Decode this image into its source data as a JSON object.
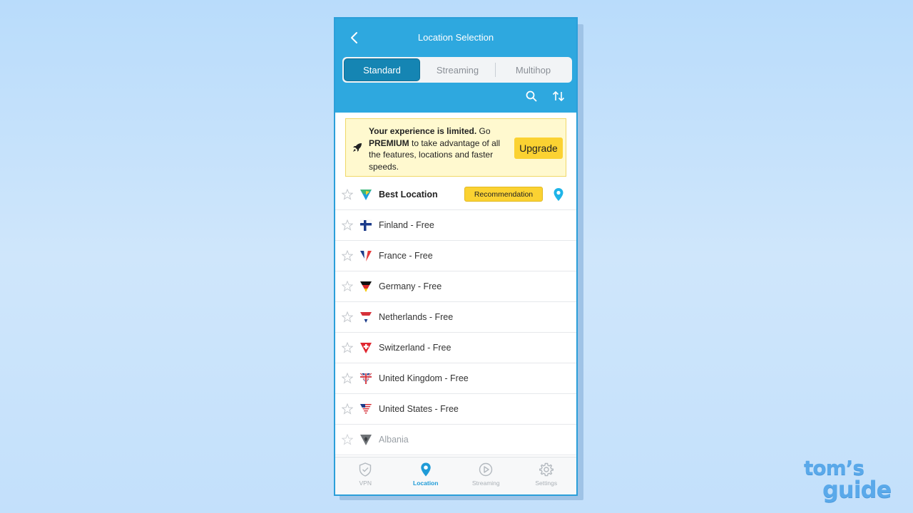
{
  "header": {
    "title": "Location Selection",
    "back_icon": "chevron-left-icon",
    "tools": [
      "search-icon",
      "sort-icon"
    ]
  },
  "tabs": [
    {
      "label": "Standard",
      "active": true
    },
    {
      "label": "Streaming",
      "active": false
    },
    {
      "label": "Multihop",
      "active": false
    }
  ],
  "banner": {
    "icon": "rocket-icon",
    "bold_lead": "Your experience is limited.",
    "text_go": " Go ",
    "bold_premium": "PREMIUM",
    "text_rest": " to take advantage of all the features, locations and faster speeds.",
    "button_label": "Upgrade"
  },
  "locations": [
    {
      "name": "Best Location",
      "badge": "Recommendation",
      "flag": "best-location-flag-icon",
      "bold": true,
      "pin": true
    },
    {
      "name": "Finland - Free",
      "flag": "finland-flag-icon"
    },
    {
      "name": "France - Free",
      "flag": "france-flag-icon"
    },
    {
      "name": "Germany - Free",
      "flag": "germany-flag-icon"
    },
    {
      "name": "Netherlands - Free",
      "flag": "netherlands-flag-icon"
    },
    {
      "name": "Switzerland - Free",
      "flag": "switzerland-flag-icon"
    },
    {
      "name": "United Kingdom - Free",
      "flag": "uk-flag-icon"
    },
    {
      "name": "United States - Free",
      "flag": "us-flag-icon"
    },
    {
      "name": "Albania",
      "flag": "albania-flag-icon",
      "muted": true
    }
  ],
  "bottom_nav": [
    {
      "label": "VPN",
      "icon": "shield-icon",
      "active": false
    },
    {
      "label": "Location",
      "icon": "location-pin-icon",
      "active": true
    },
    {
      "label": "Streaming",
      "icon": "play-icon",
      "active": false
    },
    {
      "label": "Settings",
      "icon": "gear-icon",
      "active": false
    }
  ],
  "watermark": {
    "line1": "tom’s",
    "line2": "guide"
  },
  "colors": {
    "header_blue": "#2ea8df",
    "active_tab": "#1585b3",
    "accent_yellow": "#fbd232",
    "banner_bg": "#fff9cf",
    "nav_active": "#1f9bd7"
  }
}
